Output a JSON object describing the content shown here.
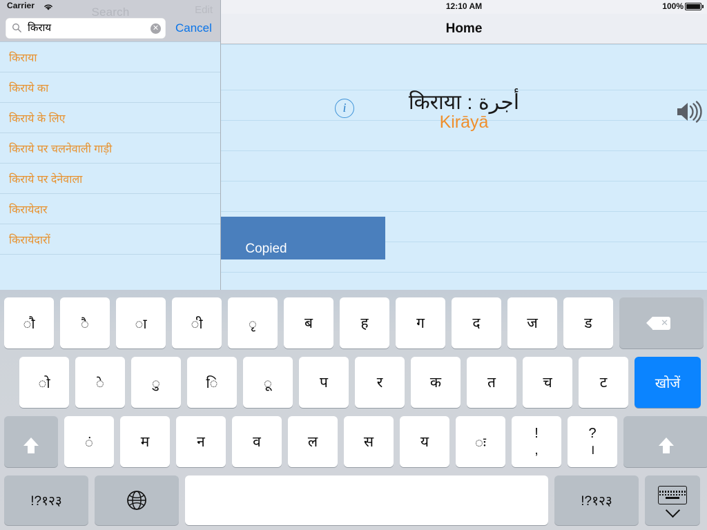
{
  "status_bar": {
    "carrier": "Carrier",
    "wifi_icon": "wifi-icon",
    "time": "12:10 AM",
    "battery_percent": "100%",
    "battery_icon": "battery-full-icon"
  },
  "left_pane": {
    "ghost_nav": {
      "title": "Search",
      "right_label": "Edit"
    },
    "search": {
      "value": "किराय",
      "placeholder": "Search",
      "search_icon": "search-icon",
      "clear_icon": "clear-icon",
      "clear_glyph": "✕"
    },
    "cancel_label": "Cancel",
    "results": [
      {
        "label": "किराया"
      },
      {
        "label": "किराये का"
      },
      {
        "label": "किराये के लिए"
      },
      {
        "label": "किराये पर चलनेवाली गाड़ी"
      },
      {
        "label": "किराये पर देनेवाला"
      },
      {
        "label": "किरायेदार"
      },
      {
        "label": "किरायेदारों"
      }
    ]
  },
  "right_pane": {
    "title": "Home",
    "entry": {
      "info_icon": "info-icon",
      "info_glyph": "i",
      "headword": "किराया : أجرة",
      "romanization": "Kirāyā",
      "speaker_icon": "speaker-icon"
    },
    "toast": {
      "message": "Copied"
    }
  },
  "keyboard": {
    "rows": [
      {
        "name": "row-1",
        "keys": [
          {
            "label": "◌ौ",
            "name": "key-au-matra",
            "type": "matra"
          },
          {
            "label": "◌ै",
            "name": "key-ai-matra",
            "type": "matra"
          },
          {
            "label": "◌ा",
            "name": "key-aa-matra",
            "type": "matra"
          },
          {
            "label": "◌ी",
            "name": "key-ii-matra",
            "type": "matra"
          },
          {
            "label": "◌ृ",
            "name": "key-vocalic-r-matra",
            "type": "matra"
          },
          {
            "label": "ब",
            "name": "key-ba",
            "type": "letter"
          },
          {
            "label": "ह",
            "name": "key-ha",
            "type": "letter"
          },
          {
            "label": "ग",
            "name": "key-ga",
            "type": "letter"
          },
          {
            "label": "द",
            "name": "key-da",
            "type": "letter"
          },
          {
            "label": "ज",
            "name": "key-ja",
            "type": "letter"
          },
          {
            "label": "ड",
            "name": "key-dda",
            "type": "letter"
          },
          {
            "label": "",
            "name": "key-backspace",
            "type": "backspace"
          }
        ]
      },
      {
        "name": "row-2",
        "keys": [
          {
            "label": "◌ो",
            "name": "key-o-matra",
            "type": "matra"
          },
          {
            "label": "◌े",
            "name": "key-e-matra",
            "type": "matra"
          },
          {
            "label": "◌ु",
            "name": "key-u-matra",
            "type": "matra"
          },
          {
            "label": "◌ि",
            "name": "key-i-matra",
            "type": "matra"
          },
          {
            "label": "◌ू",
            "name": "key-uu-matra",
            "type": "matra"
          },
          {
            "label": "प",
            "name": "key-pa",
            "type": "letter"
          },
          {
            "label": "र",
            "name": "key-ra",
            "type": "letter"
          },
          {
            "label": "क",
            "name": "key-ka",
            "type": "letter"
          },
          {
            "label": "त",
            "name": "key-ta",
            "type": "letter"
          },
          {
            "label": "च",
            "name": "key-ca",
            "type": "letter"
          },
          {
            "label": "ट",
            "name": "key-tta",
            "type": "letter"
          },
          {
            "label": "खोजें",
            "name": "key-search",
            "type": "search"
          }
        ]
      },
      {
        "name": "row-3",
        "keys": [
          {
            "label": "",
            "name": "key-shift-left",
            "type": "shift-l"
          },
          {
            "label": "◌ं",
            "name": "key-anusvara",
            "type": "matra"
          },
          {
            "label": "म",
            "name": "key-ma",
            "type": "letter"
          },
          {
            "label": "न",
            "name": "key-na",
            "type": "letter"
          },
          {
            "label": "व",
            "name": "key-va",
            "type": "letter"
          },
          {
            "label": "ल",
            "name": "key-la",
            "type": "letter"
          },
          {
            "label": "स",
            "name": "key-sa",
            "type": "letter"
          },
          {
            "label": "य",
            "name": "key-ya",
            "type": "letter"
          },
          {
            "label": "◌ः",
            "name": "key-visarga",
            "type": "matra"
          },
          {
            "label_top": "!",
            "label_bottom": ",",
            "name": "key-exclaim-comma",
            "type": "punct"
          },
          {
            "label_top": "?",
            "label_bottom": "।",
            "name": "key-question-danda",
            "type": "punct"
          },
          {
            "label": "",
            "name": "key-shift-right",
            "type": "shift-r"
          }
        ]
      },
      {
        "name": "row-4",
        "keys": [
          {
            "label": "!?१२३",
            "name": "key-numbers-left",
            "type": "numkey"
          },
          {
            "label": "",
            "name": "key-globe",
            "type": "globe"
          },
          {
            "label": "",
            "name": "key-space",
            "type": "space"
          },
          {
            "label": "!?१२३",
            "name": "key-numbers-right",
            "type": "numkey"
          },
          {
            "label": "",
            "name": "key-dismiss-keyboard",
            "type": "dismiss"
          }
        ]
      }
    ]
  },
  "colors": {
    "accent_blue": "#0b84ff",
    "link_blue": "#0a74e8",
    "orange": "#e8922f",
    "pane_blue": "#d5ecfb",
    "toast_blue": "#4a7fbd",
    "navbar_gray": "#eceef3"
  }
}
